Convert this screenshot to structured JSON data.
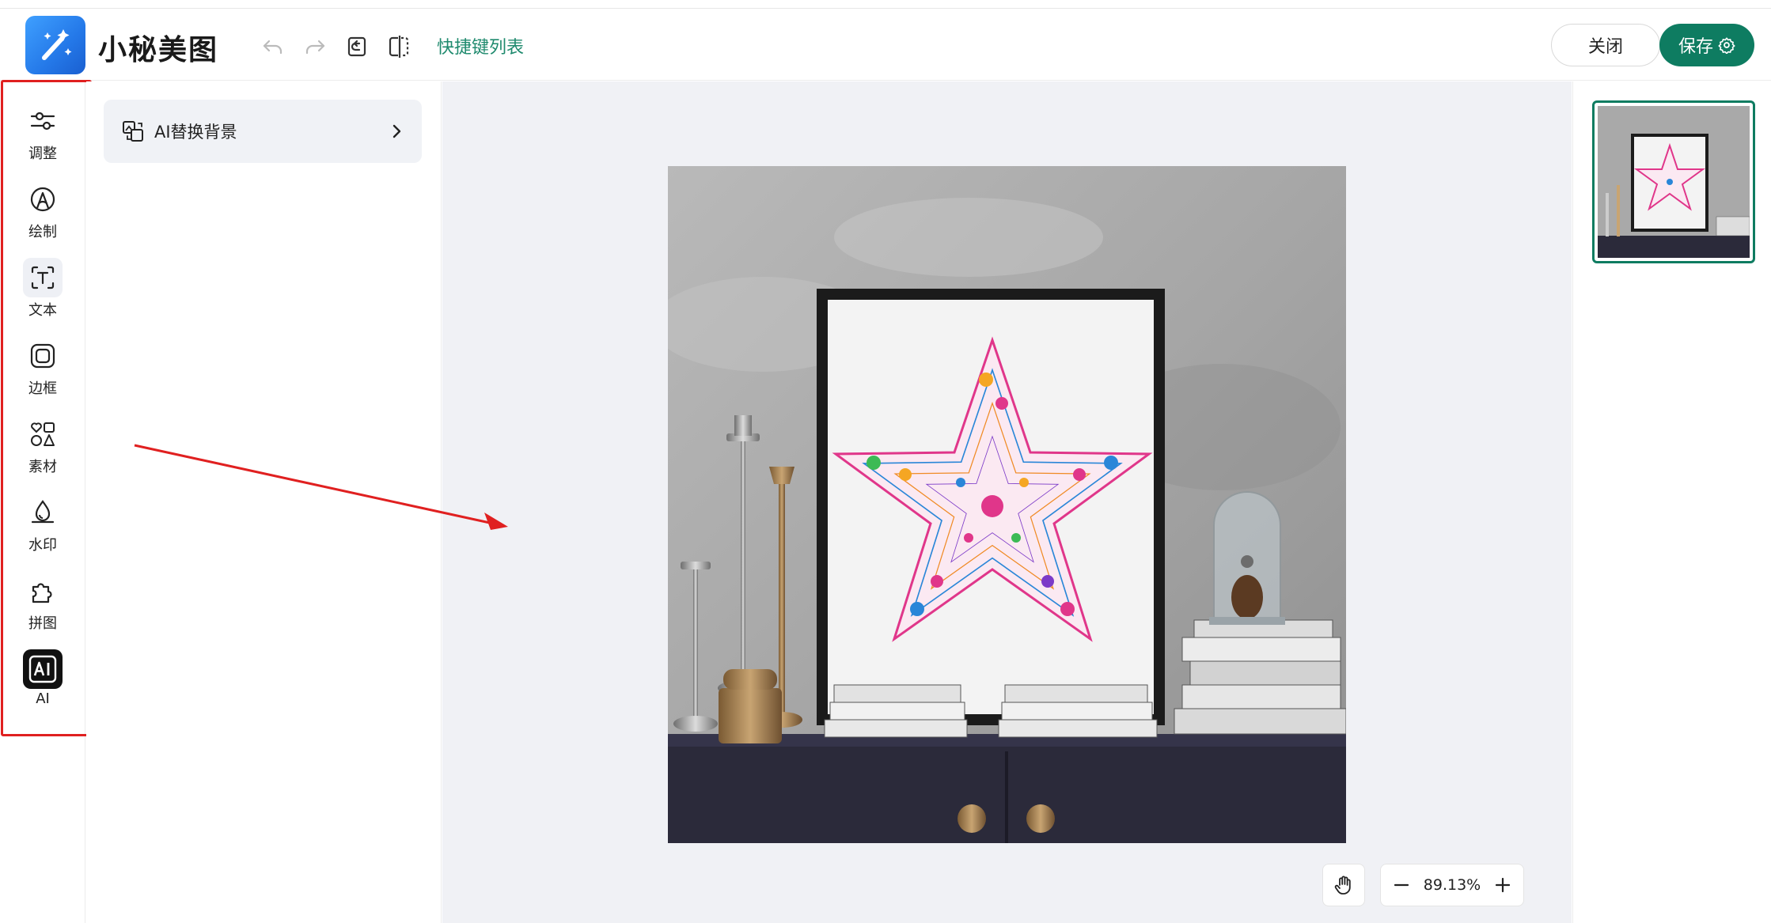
{
  "header": {
    "app_title": "小秘美图",
    "shortcut_link": "快捷键列表",
    "close_label": "关闭",
    "save_label": "保存"
  },
  "toolbar": {
    "items": [
      {
        "label": "调整",
        "icon": "sliders-icon"
      },
      {
        "label": "绘制",
        "icon": "draw-icon"
      },
      {
        "label": "文本",
        "icon": "text-icon"
      },
      {
        "label": "边框",
        "icon": "frame-icon"
      },
      {
        "label": "素材",
        "icon": "shapes-icon"
      },
      {
        "label": "水印",
        "icon": "watermark-icon"
      },
      {
        "label": "拼图",
        "icon": "puzzle-icon"
      },
      {
        "label": "AI",
        "icon": "ai-icon"
      }
    ],
    "selected": "AI"
  },
  "panel": {
    "items": [
      {
        "label": "AI替换背景",
        "icon": "replace-background-icon"
      }
    ]
  },
  "canvas": {
    "zoom": "89.13%"
  },
  "colors": {
    "accent": "#0e7c61",
    "annotation": "#e02020"
  }
}
